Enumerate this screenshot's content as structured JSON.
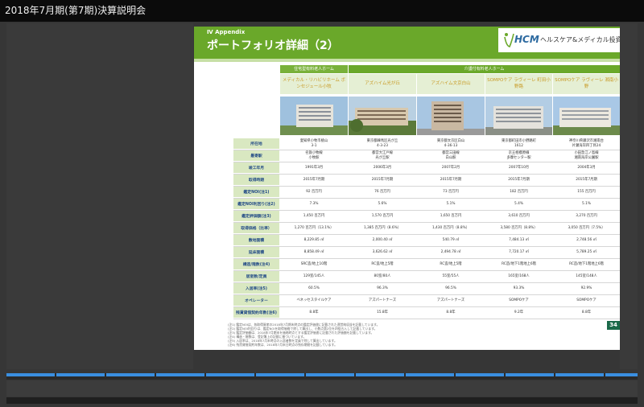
{
  "window": {
    "title": "2018年7月期(第7期)決算説明会"
  },
  "slide": {
    "section": "Ⅳ  Appendix",
    "title": "ポートフォリオ詳細（2）",
    "logo": {
      "brand": "HCM",
      "company": "ヘルスケア&メディカル投資法人"
    },
    "group_headers": [
      "住宅型有料老人ホーム",
      "介護付有料老人ホーム"
    ],
    "facilities": [
      "メディカル・リハビリホーム ボンセジュール小牧",
      "アズハイム光が丘",
      "アズハイム文京白山",
      "SOMPOケア ラヴィーレ 町田小野路",
      "SOMPOケア ラヴィーレ 湘南小野"
    ],
    "rows": [
      {
        "label": "所在地",
        "values": [
          "愛知県小牧市桃山\n3-1",
          "東京都練馬区光が丘\n4-3-23",
          "東京都文京区白山\n4-36-13",
          "東京都町田市小野路町\n1612",
          "神奈川県藤沢市湘南台\n片瀬海岸四丁目24"
        ]
      },
      {
        "label": "最寄駅",
        "values": [
          "名鉄小牧線\n小牧駅",
          "都営大江戸線\n光が丘駅",
          "都営三田線\n白山駅",
          "京王相模原線\n多摩センター駅",
          "小田急江ノ島線\n湘南海岸公園駅"
        ]
      },
      {
        "label": "竣工年月",
        "values": [
          "1991年3月",
          "2006年3月",
          "2007年2月",
          "2007年10月",
          "2004年3月"
        ]
      },
      {
        "label": "取得時期",
        "values": [
          "2015年7月期",
          "2015年7月期",
          "2015年7月期",
          "2015年7月期",
          "2015年7月期"
        ]
      },
      {
        "label": "鑑定NOI(注1)",
        "values": [
          "92 百万円",
          "76 百万円",
          "73 百万円",
          "182 百万円",
          "155 百万円"
        ]
      },
      {
        "label": "鑑定NOI利回り(注2)",
        "values": [
          "7.3%",
          "5.6%",
          "5.1%",
          "5.4%",
          "5.1%"
        ]
      },
      {
        "label": "鑑定評価額(注3)",
        "values": [
          "1,450 百万円",
          "1,570 百万円",
          "1,650 百万円",
          "3,610 百万円",
          "3,270 百万円"
        ]
      },
      {
        "label": "取得価格（比率）",
        "values": [
          "1,270 百万円（13.1%）",
          "1,385 百万円（8.6%）",
          "1,430 百万円（8.8%）",
          "3,580 百万円（8.8%）",
          "3,050 百万円（7.5%）"
        ]
      },
      {
        "label": "敷地面積",
        "values": [
          "8,229.85 ㎡",
          "2,000.40 ㎡",
          "540.79 ㎡",
          "7,484.13 ㎡",
          "2,748.56 ㎡"
        ]
      },
      {
        "label": "延床面積",
        "values": [
          "8,858.49 ㎡",
          "3,626.62 ㎡",
          "2,494.78 ㎡",
          "7,720.17 ㎡",
          "5,789.25 ㎡"
        ]
      },
      {
        "label": "構造/階数(注4)",
        "values": [
          "SRC造/地上10階",
          "RC造/地上5階",
          "RC造/地上5階",
          "RC造/地下1階地上6階",
          "RC造/地下1階地上6階"
        ]
      },
      {
        "label": "居室数/定員",
        "values": [
          "129室/145人",
          "80室/80人",
          "55室/55人",
          "165室/168人",
          "145室/148人"
        ]
      },
      {
        "label": "入居率(注5)",
        "values": [
          "60.5%",
          "96.3%",
          "96.5%",
          "93.3%",
          "92.9%"
        ]
      },
      {
        "label": "オペレーター",
        "values": [
          "ベネッセスタイルケア",
          "アズパートナーズ",
          "アズパートナーズ",
          "SOMPOケア",
          "SOMPOケア"
        ]
      },
      {
        "label": "残賃貸借契約年数(注6)",
        "values": [
          "8.8年",
          "15.8年",
          "8.8年",
          "9.2年",
          "8.8年"
        ]
      }
    ],
    "notes": [
      "(注1) 鑑定NOIは、各取得資産の2018年7月期末時点の鑑定評価書に記載された運営純収益を記載しています。",
      "(注2) 鑑定NOI利回りは、鑑定NOIを取得価格で除して算出し、小数点第2位を四捨五入して記載しています。",
      "(注3) 鑑定評価額は、2018年7月期末を価格時点とする鑑定評価書に記載された評価額を記載しています。",
      "(注4) 構造・階数は、登記簿上の記載に基づいています。",
      "(注5) 入居率は、2018年7月末時点の入居者数を定員で除して算出しています。",
      "(注6) 残賃貸借契約年数は、2018年7月末日時点の残存期間を記載しています。"
    ],
    "page_number": "34"
  },
  "colors": {
    "header_green": "#6aa82a",
    "label_fill": "#d9e8c1",
    "label_text": "#214a86",
    "facility_text": "#c89a24",
    "timeline_blue": "#3a8fe0"
  }
}
